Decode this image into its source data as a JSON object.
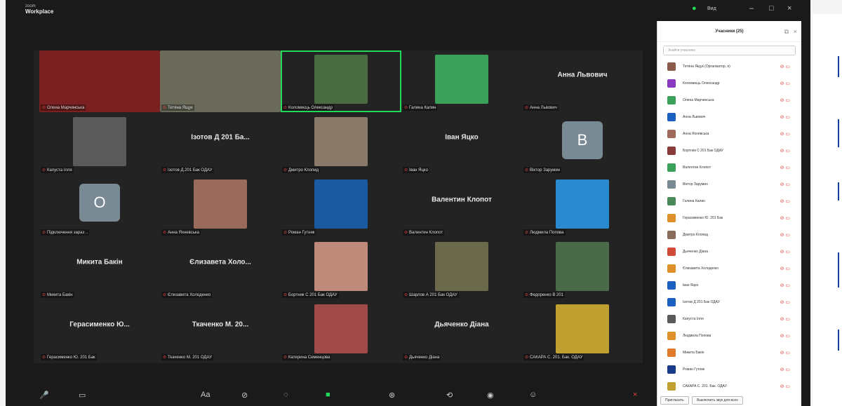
{
  "app": {
    "brand_top": "zoom",
    "brand": "Workplace",
    "ctrl_label": "Вид"
  },
  "tiles": [
    {
      "label": "Олена Марчинська",
      "kind": "video",
      "color": "#7a2020"
    },
    {
      "label": "Тетяна Ящук",
      "kind": "video",
      "color": "#6a6a5a"
    },
    {
      "label": "Коломиєць Олександр",
      "kind": "video",
      "color": "#4a6a40",
      "active": true
    },
    {
      "label": "Галина Калин",
      "kind": "video",
      "color": "#3aa05a"
    },
    {
      "label": "Анна Львович",
      "name": "Анна Львович"
    },
    {
      "label": "Капуста Ілля",
      "kind": "video",
      "color": "#5a5a5a"
    },
    {
      "label": "Ізотов Д.201 Бак ОДАУ",
      "name": "Ізотов Д 201 Ба..."
    },
    {
      "label": "Дмитро Клопид",
      "kind": "video",
      "color": "#8a7a6a"
    },
    {
      "label": "Іван Яцко",
      "name": "Іван Яцко"
    },
    {
      "label": "Віктор Зарумин",
      "letter": "B"
    },
    {
      "label": "Підключення зараз ..",
      "letter": "O"
    },
    {
      "label": "Анна Яхневська",
      "kind": "video",
      "color": "#9a6a5a"
    },
    {
      "label": "Роман Гутник",
      "kind": "video",
      "color": "#1a5aa0"
    },
    {
      "label": "Валентин Клопот",
      "name": "Валентин Клопот"
    },
    {
      "label": "Людмила Попова",
      "kind": "video",
      "color": "#2a8ad0"
    },
    {
      "label": "Микита Бакін",
      "name": "Микита Бакін"
    },
    {
      "label": "Єлизавета Холоденко",
      "name": "Єлизавета Холо..."
    },
    {
      "label": "Бортник С 201 Бак ОДАУ",
      "kind": "video",
      "color": "#c08a7a"
    },
    {
      "label": "Шарлов А 201 Бак ОДАУ",
      "kind": "video",
      "color": "#6a6a4a"
    },
    {
      "label": "Федоренко В 201",
      "kind": "video",
      "color": "#4a6a4a"
    },
    {
      "label": "Герасименко Ю. 201 Бак",
      "name": "Герасименко Ю..."
    },
    {
      "label": "Ткаченко М. 201 ОДАУ",
      "name": "Ткаченко М. 20..."
    },
    {
      "label": "Катерина Семенцова",
      "kind": "video",
      "color": "#a04a4a"
    },
    {
      "label": "Дьяченко Діана",
      "name": "Дьяченко Діана"
    },
    {
      "label": "САКАРА С. 201. Бак. ОДАУ",
      "kind": "video",
      "color": "#c0a030"
    }
  ],
  "panel": {
    "title": "Учасники (25)",
    "search": "Знайти учасника",
    "participants": [
      {
        "n": "Тетяна Ящук (Організатор, я)",
        "c": "#8a5a4a"
      },
      {
        "n": "Коломиєць Олександр",
        "c": "#8a3ac0"
      },
      {
        "n": "Олена Марчинська",
        "c": "#3aa05a"
      },
      {
        "n": "Анна Львович",
        "c": "#1a60c0"
      },
      {
        "n": "Анна Яхневська",
        "c": "#a06a5a"
      },
      {
        "n": "Бортник С 201 Бак ОДАУ",
        "c": "#8a3a3a"
      },
      {
        "n": "Валентин Клопот",
        "c": "#3aa05a"
      },
      {
        "n": "Віктор Зарумин",
        "c": "#7a8a95"
      },
      {
        "n": "Галина Калин",
        "c": "#4a8a5a"
      },
      {
        "n": "Герасименко Ю. 201 Бак",
        "c": "#e0902a"
      },
      {
        "n": "Дмитро Клопид",
        "c": "#8a6a5a"
      },
      {
        "n": "Дьяченко Діана",
        "c": "#d04a3a"
      },
      {
        "n": "Єлизавета Холоденко",
        "c": "#e0902a"
      },
      {
        "n": "Іван Яцко",
        "c": "#1a60c0"
      },
      {
        "n": "Ізотов Д 201 Бак ОДАУ",
        "c": "#1a60c0"
      },
      {
        "n": "Капуста Ілля",
        "c": "#5a5a5a"
      },
      {
        "n": "Людмила Попова",
        "c": "#e0902a"
      },
      {
        "n": "Микита Бакін",
        "c": "#e07a2a"
      },
      {
        "n": "Роман Гутник",
        "c": "#1a3a8a"
      },
      {
        "n": "САКАРА С. 201. Бак. ОДАУ",
        "c": "#c0a030"
      }
    ],
    "invite": "Пригласить",
    "mute_all": "Выключить звук для всех"
  }
}
